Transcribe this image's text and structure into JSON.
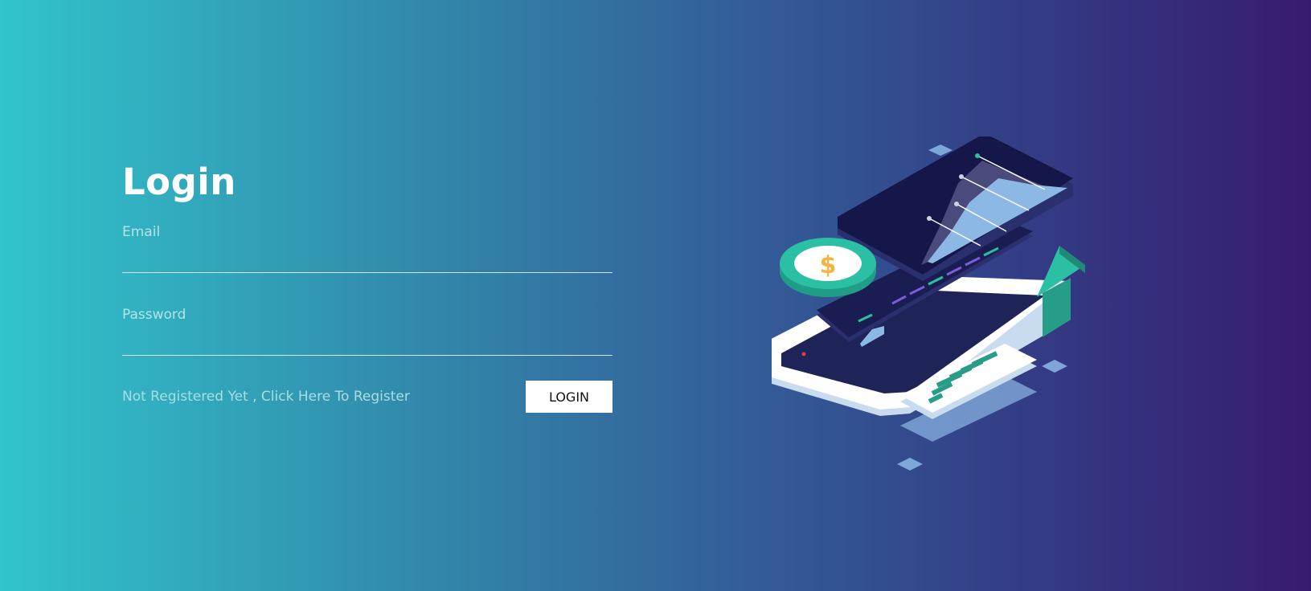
{
  "login": {
    "title": "Login",
    "email_label": "Email",
    "email_value": "",
    "password_label": "Password",
    "password_value": "",
    "register_link": "Not Registered Yet , Click Here To Register",
    "login_button": "LOGIN"
  },
  "illustration": {
    "coin_symbol": "$",
    "colors": {
      "teal": "#2bbfa3",
      "gold": "#f2b544",
      "navy": "#17184f",
      "light_blue": "#8cb8e6",
      "arrow": "#279c87"
    }
  }
}
